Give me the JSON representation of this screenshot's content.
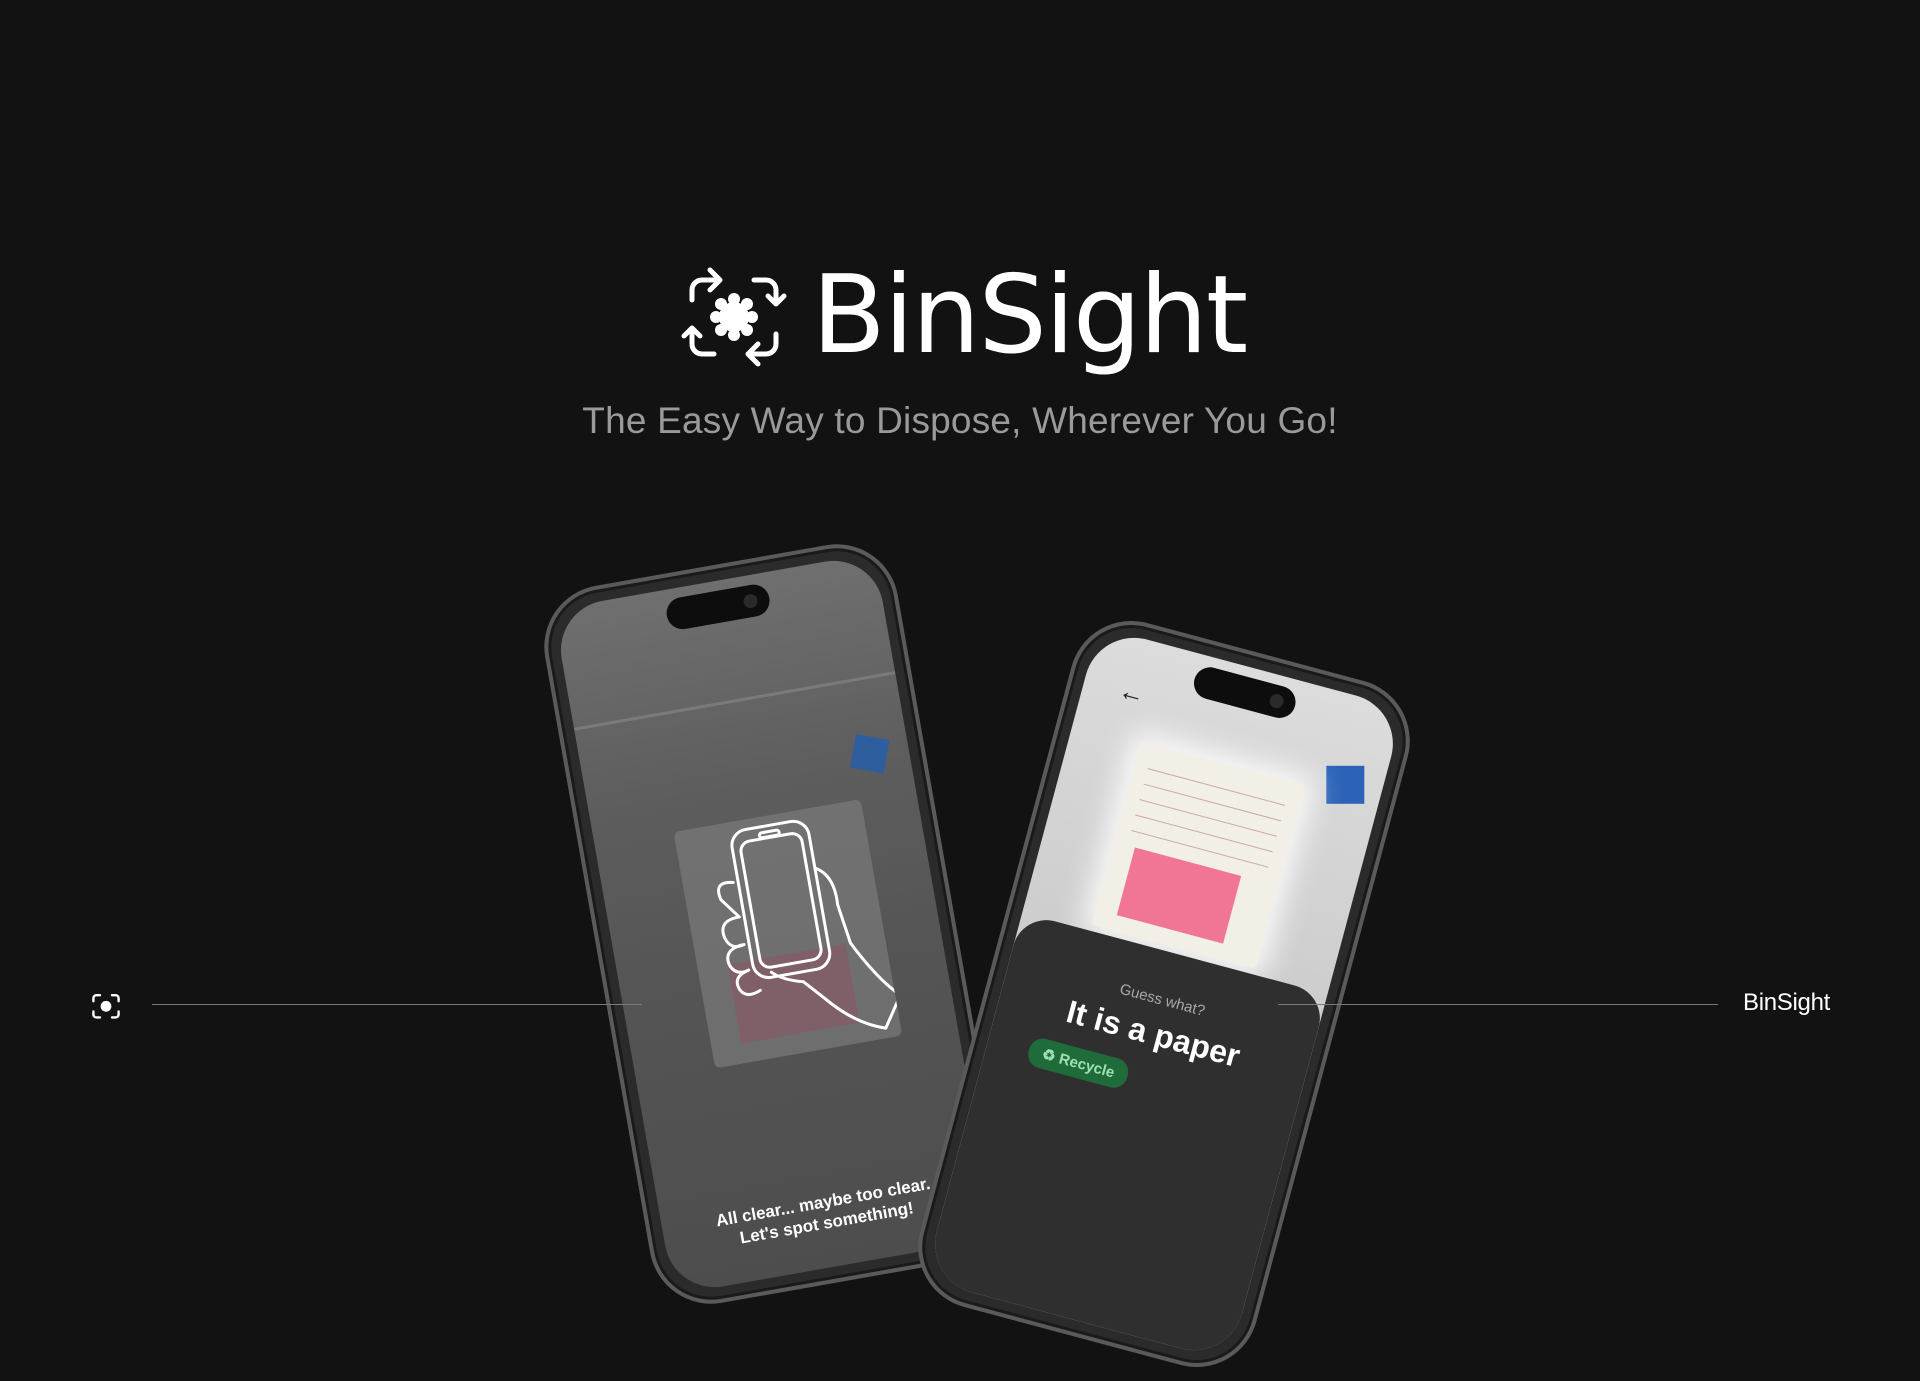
{
  "brand": {
    "name": "BinSight",
    "tagline": "The Easy Way to Dispose, Wherever You Go!"
  },
  "phones": {
    "left": {
      "message_line1": "All clear... maybe too clear.",
      "message_line2": "Let's spot something!"
    },
    "right": {
      "kicker": "Guess what?",
      "result": "It is a paper",
      "chip": "Recycle"
    }
  },
  "footer": {
    "brand": "BinSight"
  },
  "colors": {
    "background": "#121212",
    "tagline": "#9a9a9a",
    "accent_green": "#1f6b3a"
  }
}
